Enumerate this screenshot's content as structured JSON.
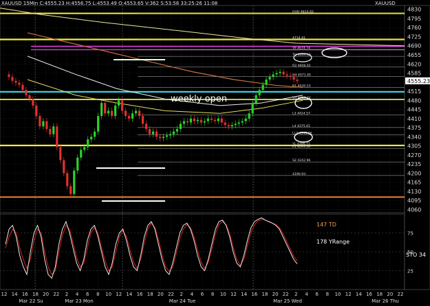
{
  "header": {
    "symbol": "XAUUSD",
    "timeframe": "15Min",
    "stats": "C:4555.23  H:4556.75  L:4553.49  O:4553.65  V:362  S:53:58  33:25:26  11:08",
    "right_title": "XAUUSD"
  },
  "chart_data": {
    "type": "line",
    "title": "",
    "price_axis_ticks": [
      4830,
      4795,
      4760,
      4725,
      4690,
      4655,
      4620,
      4585,
      4555.23,
      4515,
      4480,
      4445,
      4410,
      4375,
      4340,
      4305,
      4270,
      4235,
      4200,
      4165,
      4130,
      4095,
      4060
    ],
    "last_price": "4555.23",
    "x_ticks": [
      "12",
      "14",
      "16",
      "18",
      "20",
      "22",
      "2",
      "4",
      "6",
      "8",
      "10",
      "12",
      "14",
      "16",
      "18",
      "20",
      "22",
      "2",
      "4",
      "6",
      "8",
      "10",
      "12",
      "14",
      "16",
      "18",
      "20",
      "22",
      "2",
      "4",
      "6",
      "8",
      "10",
      "12",
      "14",
      "16",
      "18",
      "20",
      "22"
    ],
    "date_labels": [
      "Mar 22 Su",
      "Mar 23 Mon",
      "Mar 24 Tue",
      "Mar 25 Wed",
      "Mar 26 Thu"
    ],
    "levels": [
      {
        "label": "HHH 4814.83",
        "value": 4814.8
      },
      {
        "label": "4714.41",
        "value": 4714.4
      },
      {
        "label": "YP 4674.74",
        "value": 4674.7
      },
      {
        "label": "TH 4649.33",
        "value": 4649.3
      },
      {
        "label": "R2 4608.02",
        "value": 4608.0
      },
      {
        "label": "H4 4571.45",
        "value": 4571.5
      },
      {
        "label": "R1 4530.23",
        "value": 4530.2
      },
      {
        "label": "YH 4483.74",
        "value": 4483.7
      },
      {
        "label": "L3 4424.57",
        "value": 4424.6
      },
      {
        "label": "L4 4375.61",
        "value": 4375.6
      },
      {
        "label": "LL3 4346.96",
        "value": 4347.0
      },
      {
        "label": "YL 4306.71",
        "value": 4306.7
      },
      {
        "label": "L5 4295.50",
        "value": 4295.5
      },
      {
        "label": "S2 4242.96",
        "value": 4243.0
      },
      {
        "label": "4190.93",
        "value": 4190.9
      }
    ],
    "annotation": "weekly open",
    "weekly_open": 4513,
    "price_series": [
      4580,
      4570,
      4555,
      4548,
      4540,
      4520,
      4500,
      4485,
      4460,
      4420,
      4380,
      4400,
      4370,
      4350,
      4380,
      4300,
      4250,
      4200,
      4150,
      4120,
      4210,
      4260,
      4290,
      4300,
      4330,
      4340,
      4360,
      4420,
      4470,
      4430,
      4440,
      4420,
      4460,
      4480,
      4440,
      4420,
      4410,
      4430,
      4440,
      4420,
      4390,
      4370,
      4350,
      4360,
      4340,
      4335,
      4340,
      4345,
      4350,
      4360,
      4370,
      4390,
      4400,
      4395,
      4410,
      4400,
      4405,
      4395,
      4400,
      4410,
      4405,
      4400,
      4410,
      4395,
      4385,
      4380,
      4385,
      4390,
      4395,
      4400,
      4410,
      4430,
      4470,
      4500,
      4520,
      4540,
      4560,
      4570,
      4580,
      4585,
      4590,
      4580,
      4575,
      4570,
      4560,
      4555
    ],
    "subchart": {
      "labels": [
        "147 TD",
        "178 YRange",
        "STO  34"
      ],
      "ticks": [
        75,
        50,
        25
      ],
      "stoch_k": [
        60,
        80,
        85,
        70,
        45,
        30,
        20,
        50,
        75,
        85,
        70,
        40,
        20,
        15,
        30,
        60,
        80,
        90,
        75,
        55,
        35,
        25,
        40,
        65,
        80,
        85,
        70,
        50,
        30,
        20,
        35,
        60,
        75,
        80,
        65,
        45,
        30,
        25,
        45,
        70,
        85,
        90,
        80,
        60,
        40,
        25,
        20,
        35,
        55,
        75,
        85,
        88,
        80,
        65,
        45,
        30,
        25,
        40,
        60,
        80,
        90,
        92,
        85,
        70,
        50,
        35,
        30,
        45,
        65,
        82,
        90,
        93,
        95,
        92,
        90,
        88,
        85,
        80,
        70,
        60,
        50,
        40,
        34
      ],
      "stoch_d": [
        55,
        70,
        80,
        75,
        55,
        40,
        28,
        40,
        65,
        80,
        75,
        50,
        30,
        20,
        25,
        50,
        72,
        85,
        80,
        62,
        42,
        30,
        35,
        55,
        75,
        82,
        75,
        55,
        38,
        25,
        30,
        50,
        70,
        78,
        70,
        52,
        36,
        28,
        40,
        62,
        80,
        88,
        82,
        66,
        46,
        30,
        24,
        30,
        48,
        68,
        80,
        86,
        82,
        70,
        52,
        36,
        28,
        36,
        54,
        74,
        86,
        90,
        86,
        74,
        56,
        40,
        32,
        40,
        58,
        76,
        86,
        91,
        93,
        92,
        90,
        88,
        86,
        82,
        74,
        64,
        54,
        44,
        38
      ]
    }
  },
  "colors": {
    "background": "#000000",
    "grid": "#3a3a3a",
    "candle_up": "#2bd22b",
    "candle_down": "#e23030",
    "weekly_open": "#36e0f0",
    "yellow": "#f5ef3c",
    "magenta": "#e040e0",
    "orange": "#f08030",
    "stoch_k": "#e8e8e8",
    "stoch_d": "#e02020"
  }
}
